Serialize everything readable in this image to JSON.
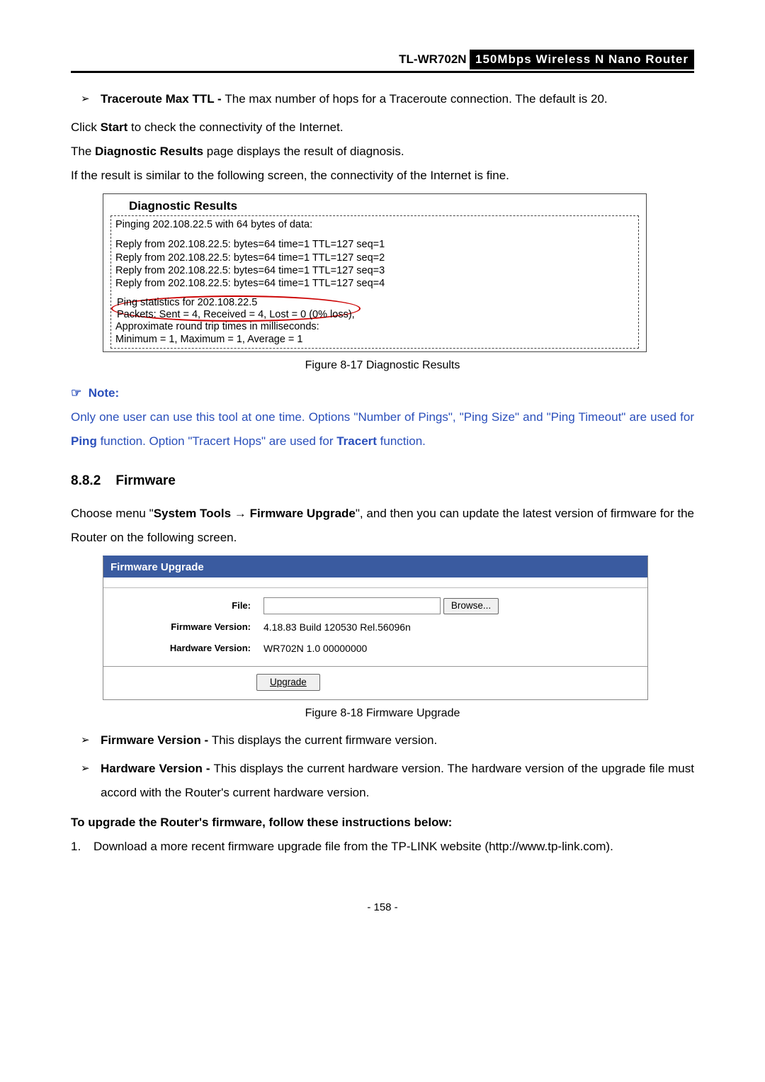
{
  "header": {
    "model": "TL-WR702N",
    "product": "150Mbps Wireless N Nano Router"
  },
  "bullet_ttl": {
    "term": "Traceroute Max TTL - ",
    "text": "The max number of hops for a Traceroute connection. The default is 20."
  },
  "para_start": {
    "p1": "Click ",
    "b1": "Start",
    "p2": " to check the connectivity of the Internet."
  },
  "para_diag": {
    "p1": "The ",
    "b1": "Diagnostic Results",
    "p2": " page displays the result of diagnosis."
  },
  "para_sim": "If the result is similar to the following screen, the connectivity of the Internet is fine.",
  "diag": {
    "title": "Diagnostic Results",
    "l1": "Pinging 202.108.22.5 with 64 bytes of data:",
    "r1": "Reply from 202.108.22.5:  bytes=64  time=1  TTL=127  seq=1",
    "r2": "Reply from 202.108.22.5:  bytes=64  time=1  TTL=127  seq=2",
    "r3": "Reply from 202.108.22.5:  bytes=64  time=1  TTL=127  seq=3",
    "r4": "Reply from 202.108.22.5:  bytes=64  time=1  TTL=127  seq=4",
    "s1": "Ping statistics for 202.108.22.5",
    "s2": "  Packets: Sent = 4, Received = 4, Lost = 0 (0% loss),",
    "s3": "Approximate round trip times in milliseconds:",
    "s4": "  Minimum = 1, Maximum = 1, Average = 1"
  },
  "caption1": "Figure 8-17    Diagnostic Results",
  "note": {
    "icon": "☞",
    "label": "Note:",
    "body_p1": "Only one user can use this tool at one time. Options \"Number of Pings\", \"Ping Size\" and \"Ping Timeout\" are used for ",
    "body_b1": "Ping",
    "body_p2": " function. Option \"Tracert Hops\" are used for ",
    "body_b2": "Tracert",
    "body_p3": " function."
  },
  "section": {
    "num": "8.8.2",
    "title": "Firmware"
  },
  "fw_intro": {
    "p1": "Choose menu \"",
    "b1": "System Tools",
    "arrow": " → ",
    "b2": "Firmware Upgrade",
    "p2": "\", and then you can update the latest version of firmware for the Router on the following screen."
  },
  "fwbox": {
    "header": "Firmware Upgrade",
    "file_label": "File:",
    "browse": "Browse...",
    "fv_label": "Firmware Version:",
    "fv_val": "4.18.83 Build 120530 Rel.56096n",
    "hv_label": "Hardware Version:",
    "hv_val": "WR702N 1.0 00000000",
    "upgrade": "Upgrade"
  },
  "caption2": "Figure 8-18    Firmware Upgrade",
  "bullet_fv": {
    "term": "Firmware Version - ",
    "text": "This displays the current firmware version."
  },
  "bullet_hv": {
    "term": "Hardware Version - ",
    "text": "This displays the current hardware version. The hardware version of the upgrade file must accord with the Router's current hardware version."
  },
  "instr_head": "To upgrade the Router's firmware, follow these instructions below:",
  "ol1": {
    "num": "1.",
    "text": "Download a more recent firmware upgrade file from the TP-LINK website (http://www.tp-link.com)."
  },
  "pagenum": "- 158 -"
}
